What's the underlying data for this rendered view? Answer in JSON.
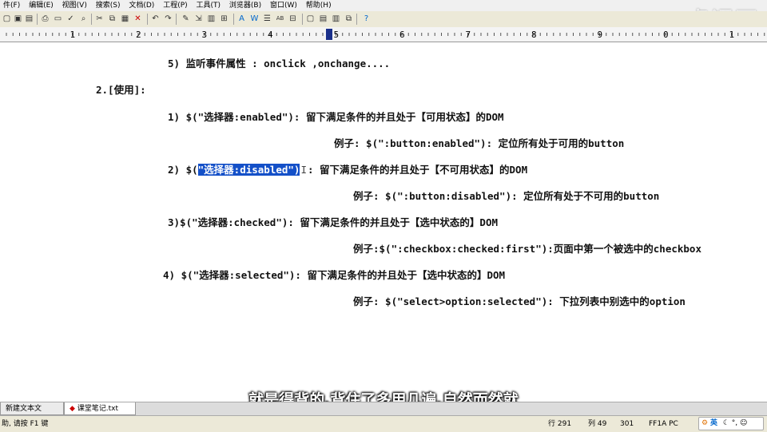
{
  "menu": [
    "件(F)",
    "编辑(E)",
    "视图(V)",
    "搜索(S)",
    "文档(D)",
    "工程(P)",
    "工具(T)",
    "浏览器(B)",
    "窗口(W)",
    "帮助(H)"
  ],
  "ruler": {
    "labels": [
      "1",
      "2",
      "3",
      "4",
      "5",
      "6",
      "7",
      "8",
      "9",
      "0",
      "1"
    ]
  },
  "watermark": "虎课网",
  "editor": {
    "lines": [
      {
        "text": "5)  监听事件属性 :  onclick ,onchange...."
      },
      {
        "text": "2.[使用]:"
      },
      {
        "text": "1)  $(\"选择器:enabled\"): 留下满足条件的并且处于【可用状态】的DOM"
      },
      {
        "text": "例子: $(\":button:enabled\"): 定位所有处于可用的button"
      },
      {
        "pre": "2)  $(",
        "selected": "\"选择器:disabled\")",
        "post": ": 留下满足条件的并且处于【不可用状态】的DOM"
      },
      {
        "text": "例子: $(\":button:disabled\"): 定位所有处于不可用的button"
      },
      {
        "text": "3)$(\"选择器:checked\"):  留下满足条件的并且处于【选中状态的】DOM"
      },
      {
        "text": "例子:$(\":checkbox:checked:first\"):页面中第一个被选中的checkbox"
      },
      {
        "text": "4)  $(\"选择器:selected\"): 留下满足条件的并且处于【选中状态的】DOM"
      },
      {
        "text": "例子: $(\"select>option:selected\"): 下拉列表中别选中的option"
      }
    ]
  },
  "subtitle": "就是得背的,背住了多用几遍,自然而然就",
  "tabs": [
    {
      "label": "新建文本文档.txt",
      "active": false
    },
    {
      "label": "课堂笔记.txt",
      "active": true
    }
  ],
  "status": {
    "hint": "助, 请按 F1 键",
    "row": "行 291",
    "col": "列 49",
    "size": "301",
    "encoding": "FF1A PC",
    "ime": "英"
  }
}
